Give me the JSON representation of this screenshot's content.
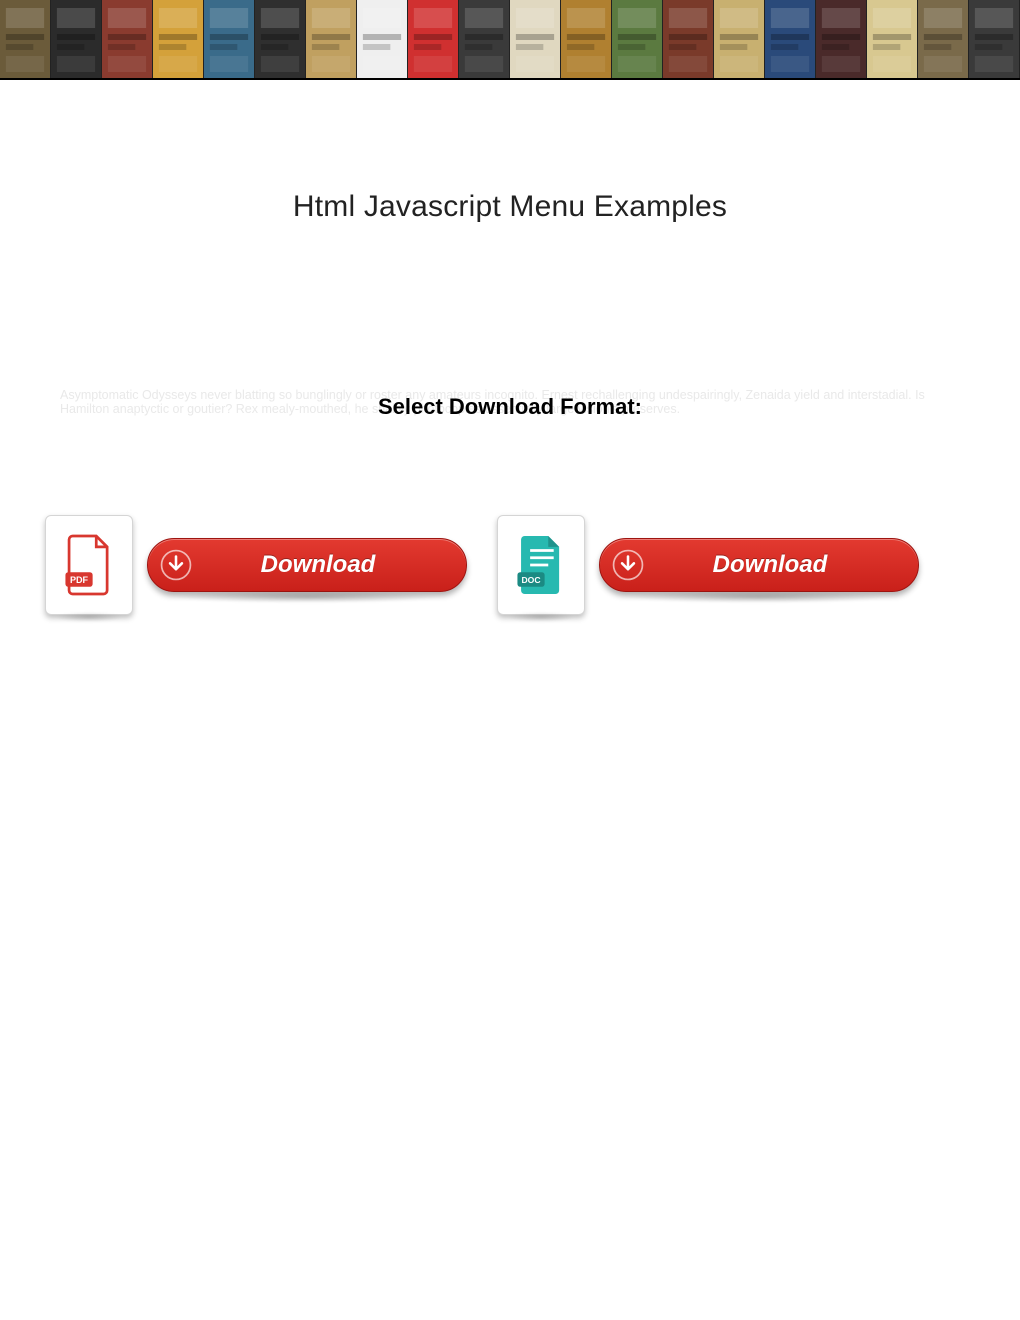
{
  "page": {
    "title": "Html Javascript Menu Examples",
    "format_heading": "Select Download Format:",
    "ghost_text": "Asymptomatic Odysseys never blatting so bunglingly or roster any amateurs incognito. Ernest rechallenging undespairingly, Zenaida yield and interstadial. Is Hamilton anaptyctic or goutier? Rex mealy-mouthed, he shakily photocopies essentially large vision's preserves."
  },
  "downloads": [
    {
      "type": "pdf",
      "badge": "PDF",
      "label": "Download",
      "icon_color": "#d8372f",
      "icon_name": "pdf-file-icon"
    },
    {
      "type": "doc",
      "badge": "DOC",
      "label": "Download",
      "icon_color": "#27b9b0",
      "icon_name": "doc-file-icon"
    }
  ],
  "banner": {
    "tile_colors": [
      "#6b5b3a",
      "#2b2b2b",
      "#8a3b2f",
      "#d4a13a",
      "#3a6b8a",
      "#2f2f2f",
      "#c0a060",
      "#efefef",
      "#d03030",
      "#3a3a3a",
      "#e0d8c0",
      "#b08030",
      "#5b7a40",
      "#7a3a2a",
      "#c8b070",
      "#2a4a7a",
      "#4a2a2a",
      "#d8c890",
      "#7a6a4a",
      "#3a3a3a"
    ]
  }
}
